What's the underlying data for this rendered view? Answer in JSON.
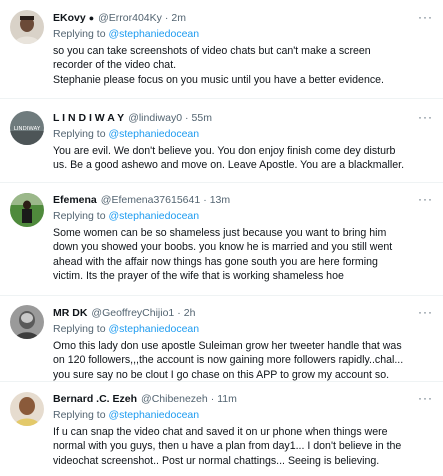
{
  "tweets": [
    {
      "name": "EKovy",
      "badge": "",
      "handle": "@Error404Ky",
      "sep": "·",
      "time": "2m",
      "reply_prefix": "Replying to",
      "reply_to": "@stephaniedocean",
      "text": "so you can take screenshots of video chats but can't make a screen\nrecorder of the video chat.\nStephanie please focus on you music until you have a better evidence.",
      "avatar_color": "#8a6a58"
    },
    {
      "name": "L I N D I W A Y",
      "handle": "@lindiway0",
      "sep": "·",
      "time": "55m",
      "reply_prefix": "Replying to",
      "reply_to": "@stephaniedocean",
      "text": "You are evil. We don't believe you. You don enjoy finish come dey disturb\nus. Be a good ashewo and move on. Leave Apostle. You are a blackmaller.",
      "avatar_label": "LINDIWAY",
      "avatar_color": "#5f6b6e"
    },
    {
      "name": "Efemena",
      "handle": "@Efemena37615641",
      "sep": "·",
      "time": "13m",
      "reply_prefix": "Replying to",
      "reply_to": "@stephaniedocean",
      "text": "Some women can be so shameless just because you want to bring him\ndown you showed your boobs. you know he is married and you still went\nahead with the affair now things has gone south you are here forming\nvictim. Its the prayer of the wife that is working shameless hoe",
      "avatar_color": "#3e7a3a"
    },
    {
      "name": "MR DK",
      "handle": "@GeoffreyChijio1",
      "sep": "·",
      "time": "2h",
      "reply_prefix": "Replying to",
      "reply_to": "@stephaniedocean",
      "text": "Omo this lady don use apostle Suleiman grow her tweeter handle that was\non 120 followers,,,the account is now gaining more followers rapidly..chal...\nyou sure say no be clout I go chase on this APP to grow my account so.",
      "avatar_color": "#7d7d7d"
    },
    {
      "name": "Bernard .C. Ezeh",
      "handle": "@Chibenezeh",
      "sep": "·",
      "time": "11m",
      "reply_prefix": "Replying to",
      "reply_to": "@stephaniedocean",
      "text": "If u can snap the video chat and saved it on ur phone when things were\nnormal with you guys, then u have a plan from day1... I don't believe in the\nvideochat screenshot.. Post ur normal chattings... Seeing is believing.",
      "avatar_color": "#a67b55"
    }
  ],
  "more_icon": "more-dots-icon",
  "colors": {
    "link": "#1d9bf0",
    "muted": "#536471",
    "divider": "#eff3f4"
  }
}
